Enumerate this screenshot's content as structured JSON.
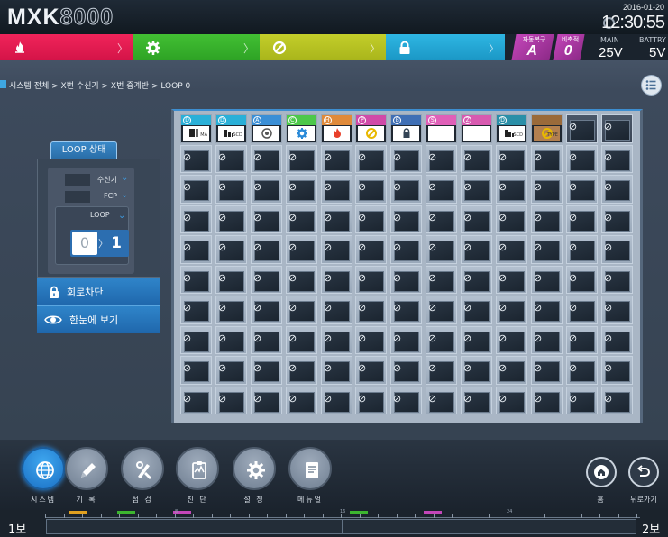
{
  "header": {
    "logo_bold": "MXK",
    "logo_outline": "8000",
    "date": "2016-01-20",
    "time": "12:30:55"
  },
  "status": {
    "fire_icon": "fire-icon",
    "trouble_icon": "gear-icon",
    "disable_icon": "prohibited-icon",
    "lock_icon": "lock-icon",
    "auto_recover_label": "자동복구",
    "auto_recover_value": "A",
    "storage_label": "비축적",
    "storage_value": "0",
    "main_label": "MAIN",
    "main_value": "25V",
    "battery_label": "BATTRY",
    "battery_value": "5V",
    "colors": {
      "fire": "#e81c52",
      "trouble": "#3db52f",
      "disable": "#b8c325",
      "lock": "#27aadb",
      "indicator": "#b03ea8"
    }
  },
  "breadcrumb": "시스템 전체 > X번 수신기 > X번 중계반 > LOOP 0",
  "left_panel": {
    "title": "LOOP 상태",
    "receiver_label": "수신기",
    "fcp_label": "FCP",
    "loop_label": "LOOP",
    "loop_from": "0",
    "loop_to": "1",
    "circuit_block_label": "회로차단",
    "overview_label": "한눈에 보기"
  },
  "grid": {
    "columns": 13,
    "rows": 10,
    "devices": [
      {
        "col": 1,
        "badge": "D",
        "color": "#2ab0d8",
        "icon": "detector-icon",
        "tag": "MA"
      },
      {
        "col": 2,
        "badge": "D",
        "color": "#2ab0d8",
        "icon": "module-icon",
        "tag": "SCD"
      },
      {
        "col": 3,
        "badge": "A",
        "color": "#3b8fd6",
        "icon": "bell-icon",
        "tag": ""
      },
      {
        "col": 4,
        "badge": "C",
        "color": "#4dc84a",
        "icon": "gear-icon",
        "tag": ""
      },
      {
        "col": 5,
        "badge": "H",
        "color": "#e08a3a",
        "icon": "fire-icon",
        "tag": ""
      },
      {
        "col": 6,
        "badge": "P",
        "color": "#d04aa8",
        "icon": "prohibited-icon",
        "tag": ""
      },
      {
        "col": 7,
        "badge": "B",
        "color": "#3f6fb5",
        "icon": "lock-icon",
        "tag": ""
      },
      {
        "col": 8,
        "badge": "S",
        "color": "#e060b8",
        "icon": "blank-icon",
        "tag": ""
      },
      {
        "col": 9,
        "badge": "Z",
        "color": "#d85ab0",
        "icon": "blank-icon",
        "tag": ""
      },
      {
        "col": 10,
        "badge": "D",
        "color": "#2a8fa8",
        "icon": "module-icon",
        "tag": "SCD"
      },
      {
        "col": 11,
        "badge": "",
        "color": "#9a6a3a",
        "icon": "prohibited-icon",
        "tag": "TYPE"
      }
    ]
  },
  "nav": [
    {
      "label": "시스템",
      "icon": "globe-icon",
      "active": true
    },
    {
      "label": "기 록",
      "icon": "pencil-icon",
      "active": false
    },
    {
      "label": "점 검",
      "icon": "tools-icon",
      "active": false
    },
    {
      "label": "진 단",
      "icon": "clipboard-icon",
      "active": false
    },
    {
      "label": "설 정",
      "icon": "gear-icon",
      "active": false
    },
    {
      "label": "메뉴얼",
      "icon": "manual-icon",
      "active": false
    }
  ],
  "right_nav": {
    "home_label": "홈",
    "back_label": "뒤로가기"
  },
  "timeline": {
    "left_label": "1보",
    "right_label": "2보",
    "mark1": "8",
    "mark2": "16",
    "mark3": "24"
  }
}
